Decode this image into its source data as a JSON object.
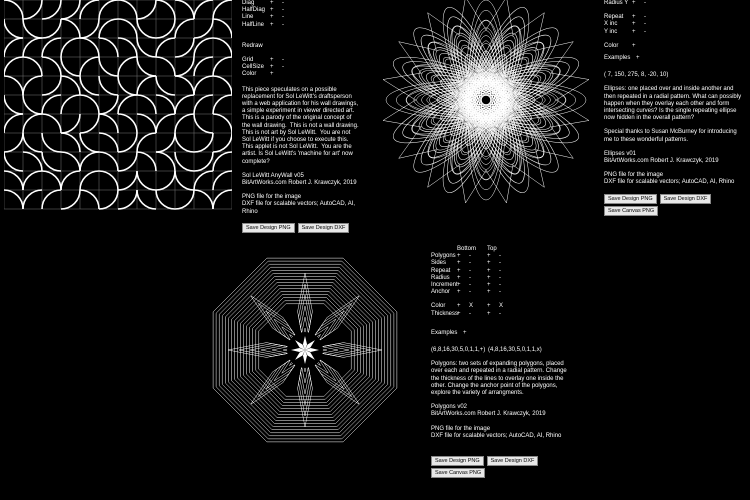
{
  "p1": {
    "line_controls": [
      {
        "label": "Diag",
        "plus": "+",
        "minus": "-"
      },
      {
        "label": "HalfDiag",
        "plus": "+",
        "minus": "-"
      },
      {
        "label": "Line",
        "plus": "+",
        "minus": "-"
      },
      {
        "label": "HalfLine",
        "plus": "+",
        "minus": "-"
      }
    ],
    "redraw_label": "Redraw",
    "grid_controls": [
      {
        "label": "Grid",
        "plus": "+",
        "minus": "-"
      },
      {
        "label": "CellSize",
        "plus": "+",
        "minus": "-"
      },
      {
        "label": "Color",
        "plus": "+",
        "minus": ""
      }
    ],
    "description": "This piece speculates on a possible replacement for Sol LeWitt's draftsperson with a web application for his wall drawings, a simple experiment in viewer directed art. This is a parody of the original concept of the wall drawing.  This is not a wall drawing.  This is not art by Sol LeWitt.  You are not Sol LeWitt if you choose to execute this.  This applet is not Sol LeWitt.  You are the artist. Is Sol LeWitt's 'machine for art' now complete?",
    "credit_title": "Sol LeWitt AnyWall v05",
    "credit_by": "BitArtWorks.com Robert J. Krawczyk, 2019",
    "file_info": "PNG file for the image\nDXF file for scalable vectors; AutoCAD, AI, Rhino",
    "buttons": [
      "Save Design PNG",
      "Save Design DXF"
    ]
  },
  "p2": {
    "controls": [
      {
        "label": "Radius Y",
        "plus": "+",
        "minus": "-"
      },
      {
        "label": "",
        "plus": "",
        "minus": ""
      },
      {
        "label": "Repeat",
        "plus": "+",
        "minus": "-"
      },
      {
        "label": "X inc",
        "plus": "+",
        "minus": "-"
      },
      {
        "label": "Y inc",
        "plus": "+",
        "minus": "-"
      }
    ],
    "color_label": "Color",
    "color_plus": "+",
    "examples_label": "Examples",
    "examples_plus": "+",
    "params": "( 7, 150, 275, 8, -20, 10)",
    "description": "Ellipses: one placed over and inside another and then repeated in a radial pattern. What can possibly happen when they overlay each other and form intersecting curves? Is the single repeating ellipse now hidden in the overall pattern?",
    "thanks": "Special thanks to Susan McBurney for introducing me to these wonderful patterns.",
    "credit_title": "Ellipses v01",
    "credit_by": "BitArtWorks.com Robert J. Krawczyk, 2019",
    "file_info": "PNG file for the image\nDXF file for scalable vectors; AutoCAD, AI, Rhino",
    "buttons": [
      "Save Design PNG",
      "Save Design DXF"
    ],
    "button2": "Save Canvas PNG"
  },
  "p3": {
    "col_bottom": "Bottom",
    "col_top": "Top",
    "rows": [
      {
        "label": "Polygons",
        "b1": "+",
        "b2": "-",
        "t1": "+",
        "t2": "-"
      },
      {
        "label": "Sides",
        "b1": "+",
        "b2": "-",
        "t1": "+",
        "t2": "-"
      },
      {
        "label": "Repeat",
        "b1": "+",
        "b2": "-",
        "t1": "+",
        "t2": "-"
      },
      {
        "label": "Radius",
        "b1": "+",
        "b2": "-",
        "t1": "+",
        "t2": "-"
      },
      {
        "label": "Increment",
        "b1": "+",
        "b2": "-",
        "t1": "+",
        "t2": "-"
      },
      {
        "label": "Anchor",
        "b1": "+",
        "b2": "-",
        "t1": "+",
        "t2": "-"
      }
    ],
    "rows2": [
      {
        "label": "Color",
        "b1": "+",
        "b2": "X",
        "t1": "+",
        "t2": "X"
      },
      {
        "label": "Thickness",
        "b1": "+",
        "b2": "-",
        "t1": "+",
        "t2": "-"
      }
    ],
    "examples_label": "Examples",
    "examples_plus": "+",
    "params_bottom": "(6,8,16,30,5,0,1,1,+)",
    "params_top": "(4,8,16,30,5,0,1,1,x)",
    "description": "Polygons: two sets of expanding polygons, placed over each and repeated in a radial pattern. Change the thickness of the lines to overlay one inside the other. Change the anchor point of the polygons, explore the variety of arrangments.",
    "credit_title": "Polygons v02",
    "credit_by": "BitArtWorks.com Robert J. Krawczyk, 2019",
    "file_info": "PNG file for the image\nDXF file for scalable vectors; AutoCAD, AI, Rhino",
    "buttons": [
      "Save Design PNG",
      "Save Design DXF"
    ],
    "button2": "Save Canvas PNG"
  }
}
